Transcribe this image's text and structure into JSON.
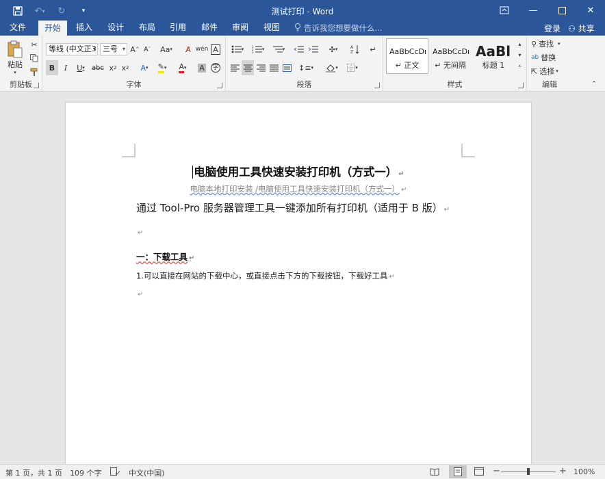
{
  "window": {
    "title": "测试打印 - Word"
  },
  "qat": {
    "save_icon": "save-icon",
    "undo_icon": "undo-icon",
    "redo_icon": "redo-icon",
    "customize_icon": "customize-qat-icon"
  },
  "tabs": [
    {
      "label": "文件"
    },
    {
      "label": "开始"
    },
    {
      "label": "插入"
    },
    {
      "label": "设计"
    },
    {
      "label": "布局"
    },
    {
      "label": "引用"
    },
    {
      "label": "邮件"
    },
    {
      "label": "审阅"
    },
    {
      "label": "视图"
    }
  ],
  "tell_me": {
    "placeholder": "告诉我您想要做什么..."
  },
  "account": {
    "login_label": "登录",
    "share_label": "共享"
  },
  "ribbon": {
    "clipboard": {
      "label": "剪贴板",
      "paste_label": "粘贴"
    },
    "font": {
      "label": "字体",
      "font_name": "等线 (中文正3",
      "font_size": "三号"
    },
    "paragraph": {
      "label": "段落"
    },
    "styles": {
      "label": "样式",
      "items": [
        {
          "sample": "AaBbCcDı",
          "name": "↵ 正文"
        },
        {
          "sample": "AaBbCcDı",
          "name": "↵ 无间隔"
        },
        {
          "sample": "AaBl",
          "name": "标题 1"
        }
      ]
    },
    "editing": {
      "label": "编辑",
      "find_label": "查找",
      "replace_label": "替换",
      "select_label": "选择"
    }
  },
  "document": {
    "title": "电脑使用工具快速安装打印机（方式一）",
    "subtitle": "电脑本地打印安装 /电脑使用工具快速安装打印机（方式一）",
    "line1": "通过 Tool-Pro 服务器管理工具一键添加所有打印机（适用于 B 版）",
    "heading": "一：下载工具",
    "step1": "1.可以直接在网站的下载中心，或直接点击下方的下载按钮，下载好工具",
    "paragraph_mark": "↵"
  },
  "status": {
    "page": "第 1 页，共 1 页",
    "words": "109 个字",
    "language": "中文(中国)",
    "zoom": "100%"
  }
}
